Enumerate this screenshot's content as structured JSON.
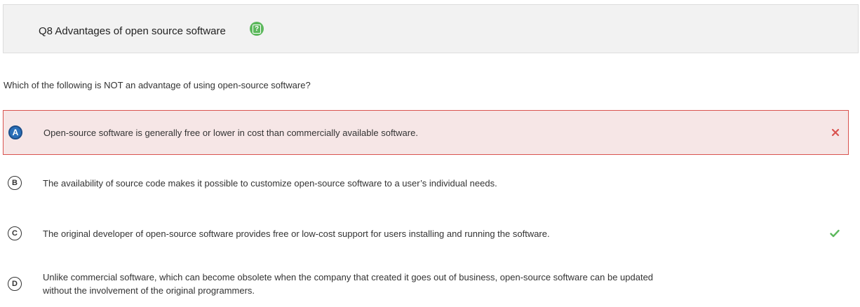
{
  "header": {
    "title": "Q8 Advantages of open source software",
    "help_icon": "help-icon",
    "help_glyph": "?"
  },
  "question": {
    "text": "Which of the following is NOT an advantage of using open-source software?"
  },
  "options": [
    {
      "letter": "A",
      "text": "Open-source software is generally free or lower in cost than commercially available software.",
      "state": "selected-incorrect",
      "mark": "x-icon"
    },
    {
      "letter": "B",
      "text": "The availability of source code makes it possible to customize open-source software to a user’s individual needs.",
      "state": "unselected"
    },
    {
      "letter": "C",
      "text": "The original developer of open-source software provides free or low-cost support for users installing and running the software.",
      "state": "correct-answer",
      "mark": "check-icon"
    },
    {
      "letter": "D",
      "text_line1": "Unlike commercial software, which can become obsolete when the company that created it goes out of business, open-source software can be updated",
      "text_line2": "without the involvement of the original programmers.",
      "state": "unselected"
    }
  ],
  "colors": {
    "incorrect": "#d9534f",
    "correct": "#5cb85c",
    "selected_letter": "#2a6fb8",
    "header_bg": "#f2f2f2"
  }
}
